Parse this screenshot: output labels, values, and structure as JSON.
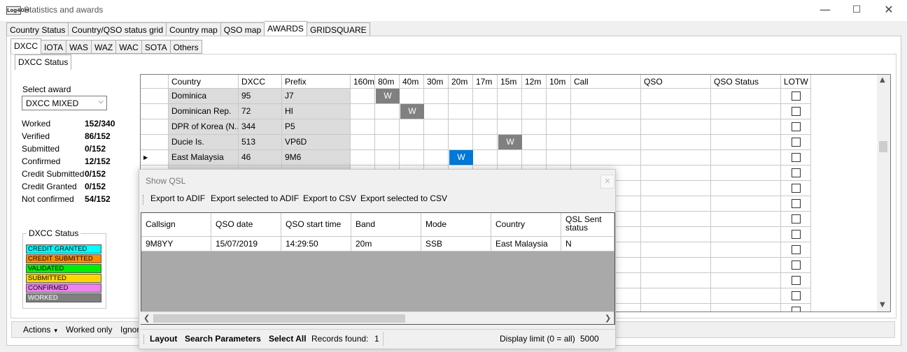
{
  "window": {
    "icon_text": "Log4OM",
    "title": "Statistics and awards",
    "minimize": "—",
    "maximize": "☐",
    "close": "✕"
  },
  "main_tabs": [
    "Country Status",
    "Country/QSO status grid",
    "Country map",
    "QSO map",
    "AWARDS",
    "GRIDSQUARE"
  ],
  "award_tabs": [
    "DXCC",
    "IOTA",
    "WAS",
    "WAZ",
    "WAC",
    "SOTA",
    "Others"
  ],
  "dxcc_tabs": [
    "DXCC Status"
  ],
  "award_select": {
    "label": "Select award",
    "value": "DXCC MIXED"
  },
  "stats": [
    {
      "label": "Worked",
      "value": "152/340"
    },
    {
      "label": "Verified",
      "value": "86/152"
    },
    {
      "label": "Submitted",
      "value": "0/152"
    },
    {
      "label": "Confirmed",
      "value": "12/152"
    },
    {
      "label": "Credit Submitted",
      "value": "0/152"
    },
    {
      "label": "Credit Granted",
      "value": "0/152"
    },
    {
      "label": "Not confirmed",
      "value": "54/152"
    }
  ],
  "legend": {
    "title": "DXCC Status",
    "items": [
      {
        "label": "CREDIT GRANTED",
        "color": "#00ffff"
      },
      {
        "label": "CREDIT SUBMITTED",
        "color": "#ff8c00"
      },
      {
        "label": "VALIDATED",
        "color": "#00ee00"
      },
      {
        "label": "SUBMITTED",
        "color": "#ffd700"
      },
      {
        "label": "CONFIRMED",
        "color": "#ee82ee"
      },
      {
        "label": "WORKED",
        "color": "#808080"
      }
    ]
  },
  "grid": {
    "columns": [
      "",
      "Country",
      "DXCC",
      "Prefix",
      "160m",
      "80m",
      "40m",
      "30m",
      "20m",
      "17m",
      "15m",
      "12m",
      "10m",
      "Call",
      "QSO",
      "QSO Status",
      "LOTW"
    ],
    "rows": [
      {
        "country": "Dominica",
        "dxcc": "95",
        "prefix": "J7",
        "mark": "W",
        "band": "80m",
        "style": "worked"
      },
      {
        "country": "Dominican Rep.",
        "dxcc": "72",
        "prefix": "HI",
        "mark": "W",
        "band": "40m",
        "style": "worked"
      },
      {
        "country": "DPR of Korea (N...",
        "dxcc": "344",
        "prefix": "P5",
        "mark": "",
        "band": "",
        "style": ""
      },
      {
        "country": "Ducie Is.",
        "dxcc": "513",
        "prefix": "VP6D",
        "mark": "W",
        "band": "15m",
        "style": "worked"
      },
      {
        "country": "East Malaysia",
        "dxcc": "46",
        "prefix": "9M6",
        "mark": "W",
        "band": "20m",
        "style": "selected"
      }
    ],
    "current_row_marker": "▶",
    "worked_color": "#808080",
    "selected_color": "#0078d7",
    "extra_checkbox_rows": 10
  },
  "qsl": {
    "title": "Show QSL",
    "close": "✕",
    "toolbar": [
      "Export to ADIF",
      "Export selected to ADIF",
      "Export to CSV",
      "Export selected to CSV"
    ],
    "columns": [
      "Callsign",
      "QSO date",
      "QSO start time",
      "Band",
      "Mode",
      "Country",
      "QSL Sent status"
    ],
    "rows": [
      [
        "9M8YY",
        "15/07/2019",
        "14:29:50",
        "20m",
        "SSB",
        "East Malaysia",
        "N"
      ]
    ],
    "status": {
      "layout": "Layout",
      "search": "Search Parameters",
      "select_all": "Select All",
      "records_label": "Records found:",
      "records_value": "1",
      "limit_label": "Display limit (0 = all)",
      "limit_value": "5000"
    }
  },
  "bottom_bar": {
    "actions": "Actions",
    "worked_only": "Worked only",
    "ignore": "Ignor"
  }
}
